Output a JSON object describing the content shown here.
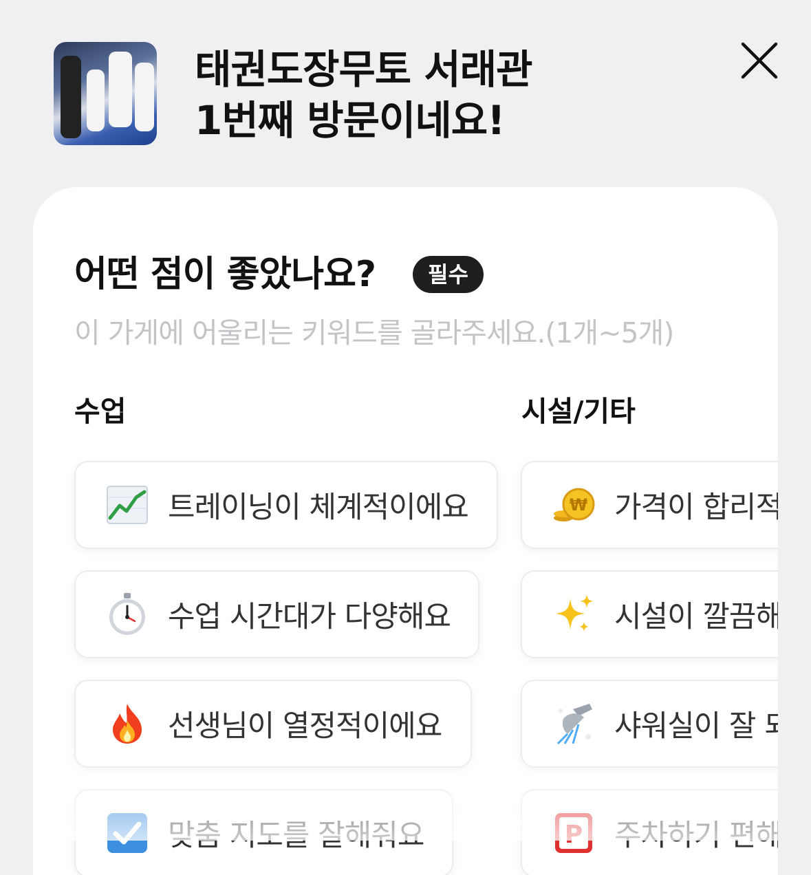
{
  "header": {
    "store_name": "태권도장무토 서래관",
    "visit_message": "1번째 방문이네요!"
  },
  "question": {
    "title": "어떤 점이 좋았나요?",
    "required_badge": "필수",
    "subtitle": "이 가게에 어울리는 키워드를 골라주세요.(1개~5개)"
  },
  "columns": {
    "class": {
      "header": "수업",
      "keywords": [
        {
          "label": "트레이닝이 체계적이에요",
          "icon": "chart-increasing-icon"
        },
        {
          "label": "수업 시간대가 다양해요",
          "icon": "stopwatch-icon"
        },
        {
          "label": "선생님이 열정적이에요",
          "icon": "fire-icon"
        },
        {
          "label": "맞춤 지도를 잘해줘요",
          "icon": "check-box-icon"
        }
      ]
    },
    "facility": {
      "header": "시설/기타",
      "keywords": [
        {
          "label": "가격이 합리적이에요",
          "icon": "coin-icon"
        },
        {
          "label": "시설이 깔끔해요",
          "icon": "sparkles-icon"
        },
        {
          "label": "샤워실이 잘 되어 있어요",
          "icon": "shower-icon"
        },
        {
          "label": "주차하기 편해요",
          "icon": "parking-icon"
        }
      ]
    }
  },
  "colors": {
    "background": "#f0f0f3",
    "badge": "#1e1e1e",
    "subtitle": "#c4c4c8"
  }
}
